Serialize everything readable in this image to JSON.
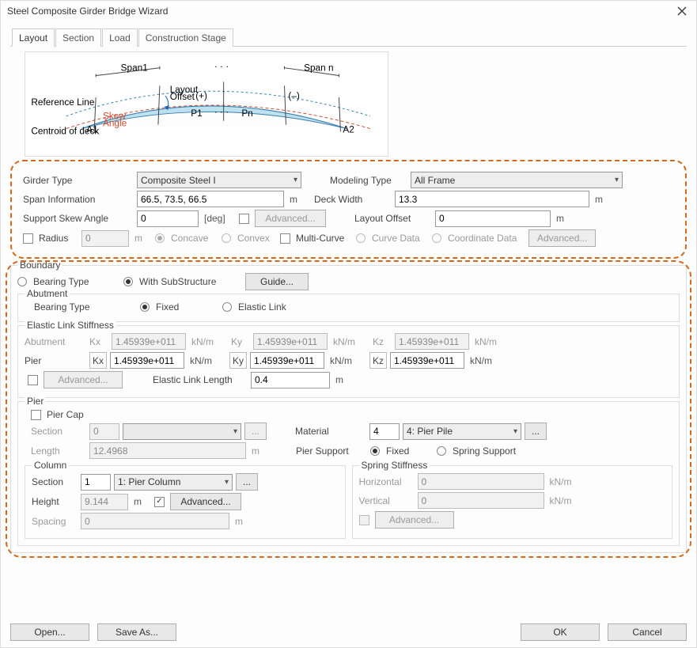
{
  "title": "Steel Composite Girder Bridge Wizard",
  "tabs": [
    "Layout",
    "Section",
    "Load",
    "Construction Stage"
  ],
  "diagram": {
    "reference_line": "Reference Line",
    "centroid": "Centroid of deck",
    "skew_angle": "Skew\nAngle",
    "layout_offset": "Layout\nOffset",
    "span1": "Span1",
    "spann": "Span n",
    "a1": "A1",
    "a2": "A2",
    "p1": "P1",
    "pn": "Pn",
    "plus": "(+)",
    "minus": "(–)"
  },
  "top": {
    "girder_type_label": "Girder Type",
    "girder_type": "Composite Steel I",
    "modeling_type_label": "Modeling Type",
    "modeling_type": "All Frame",
    "span_info_label": "Span Information",
    "span_info": "66.5, 73.5, 66.5",
    "span_unit": "m",
    "deck_width_label": "Deck Width",
    "deck_width": "13.3",
    "deck_unit": "m",
    "skew_label": "Support Skew Angle",
    "skew_value": "0",
    "skew_unit": "[deg]",
    "advanced": "Advanced...",
    "layout_offset_label": "Layout Offset",
    "layout_offset": "0",
    "layout_unit": "m",
    "radius_label": "Radius",
    "radius_value": "0",
    "radius_unit": "m",
    "concave": "Concave",
    "convex": "Convex",
    "multicurve": "Multi-Curve",
    "curvedata": "Curve Data",
    "coorddata": "Coordinate Data"
  },
  "boundary": {
    "title": "Boundary",
    "bearing_type": "Bearing Type",
    "with_sub": "With SubStructure",
    "guide": "Guide...",
    "abutment": {
      "title": "Abutment",
      "bearing_type": "Bearing Type",
      "fixed": "Fixed",
      "elastic": "Elastic Link"
    },
    "els": {
      "title": "Elastic Link Stiffness",
      "abutment": "Abutment",
      "pier": "Pier",
      "kx": "Kx",
      "ky": "Ky",
      "kz": "Kz",
      "val": "1.45939e+011",
      "unit": "kN/m",
      "advanced": "Advanced...",
      "ell_label": "Elastic Link Length",
      "ell_value": "0.4",
      "ell_unit": "m"
    },
    "pier": {
      "title": "Pier",
      "piercap": "Pier Cap",
      "section_label": "Section",
      "section_val": "0",
      "length_label": "Length",
      "length_val": "12.4968",
      "length_unit": "m",
      "material_label": "Material",
      "material_val": "4",
      "material_sel": "4: Pier Pile",
      "pier_support_label": "Pier Support",
      "fixed": "Fixed",
      "spring": "Spring Support",
      "column": {
        "title": "Column",
        "section_label": "Section",
        "section_val": "1",
        "section_sel": "1: Pier Column",
        "height_label": "Height",
        "height_val": "9.144",
        "height_unit": "m",
        "advanced": "Advanced...",
        "spacing_label": "Spacing",
        "spacing_val": "0",
        "spacing_unit": "m"
      },
      "spring_stiff": {
        "title": "Spring Stiffness",
        "horizontal": "Horizontal",
        "h_val": "0",
        "vertical": "Vertical",
        "v_val": "0",
        "unit": "kN/m",
        "advanced": "Advanced..."
      }
    }
  },
  "footer": {
    "open": "Open...",
    "save": "Save As...",
    "ok": "OK",
    "cancel": "Cancel"
  },
  "ellipsis": "..."
}
